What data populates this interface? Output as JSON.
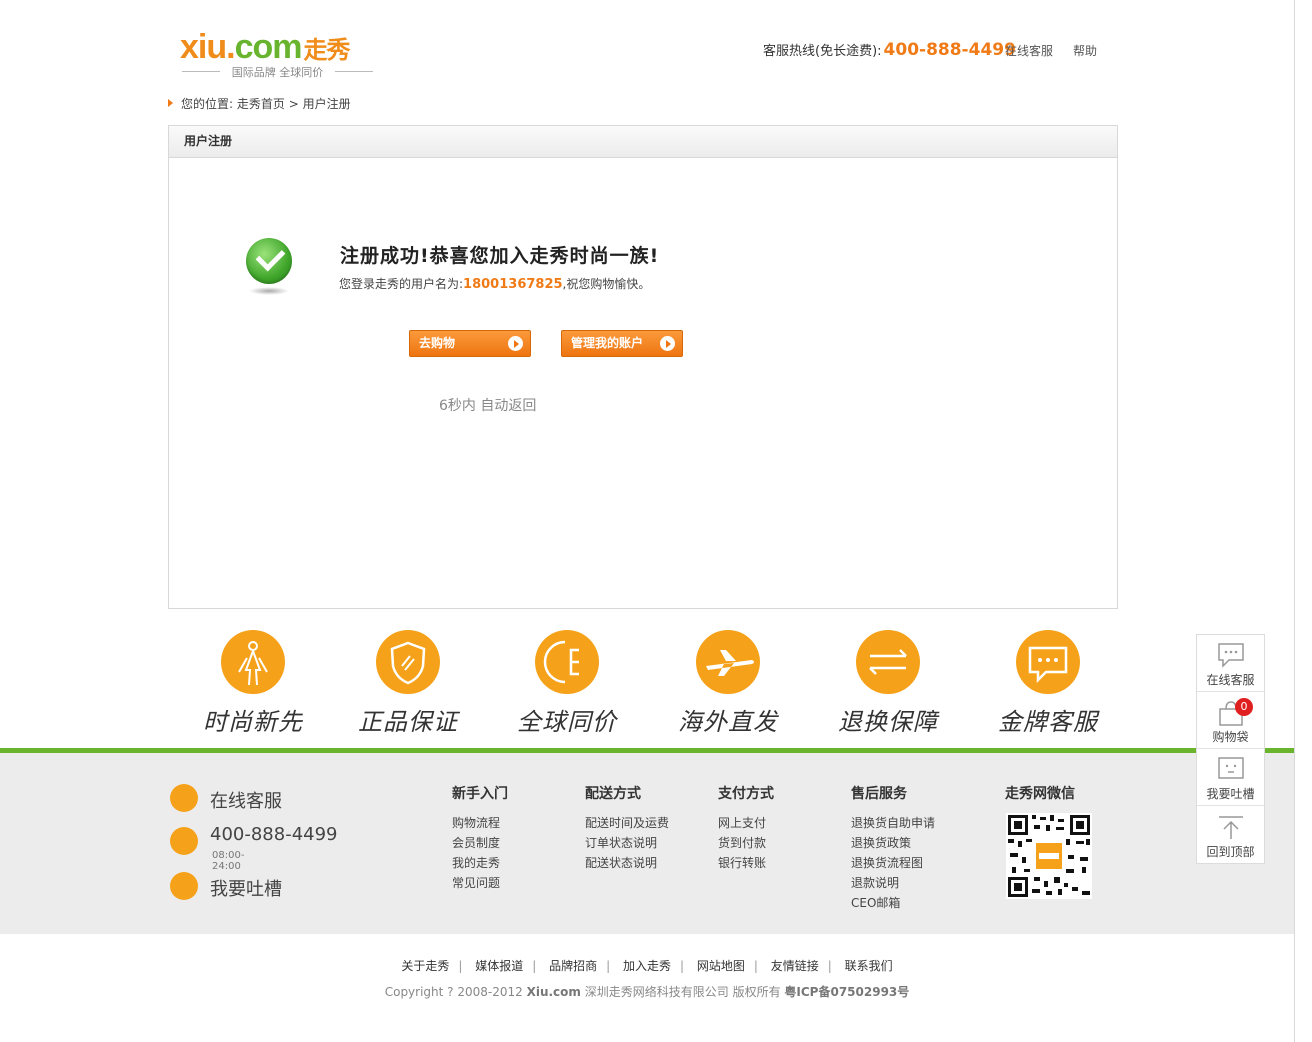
{
  "header": {
    "logo_text": "xiu.com",
    "logo_cn": "走秀",
    "logo_slogan": "国际品牌  全球同价",
    "hotline_label": "客服热线(免长途费):",
    "hotline_number": "400-888-4499",
    "link_online_service": "在线客服",
    "link_help": "帮助"
  },
  "breadcrumb": {
    "prefix": "您的位置:",
    "home": "走秀首页",
    "sep": ">",
    "current": "用户注册"
  },
  "panel": {
    "title": "用户注册",
    "success_title": "注册成功!恭喜您加入走秀时尚一族!",
    "sub_before": "您登录走秀的用户名为:",
    "username": "18001367825",
    "sub_after": ",祝您购物愉快。",
    "btn_shop": "去购物",
    "btn_account": "管理我的账户",
    "countdown": "6秒内 自动返回"
  },
  "features": [
    {
      "label": "时尚新先",
      "icon": "woman-figure-icon"
    },
    {
      "label": "正品保证",
      "icon": "shield-icon"
    },
    {
      "label": "全球同价",
      "icon": "currency-icon"
    },
    {
      "label": "海外直发",
      "icon": "airplane-icon"
    },
    {
      "label": "退换保障",
      "icon": "exchange-arrows-icon"
    },
    {
      "label": "金牌客服",
      "icon": "chat-bubble-icon"
    }
  ],
  "footer_service": {
    "online": "在线客服",
    "phone": "400-888-4499",
    "hours": "08:00-24:00",
    "feedback": "我要吐槽"
  },
  "footer_columns": [
    {
      "title": "新手入门",
      "links": [
        "购物流程",
        "会员制度",
        "我的走秀",
        "常见问题"
      ]
    },
    {
      "title": "配送方式",
      "links": [
        "配送时间及运费",
        "订单状态说明",
        "配送状态说明"
      ]
    },
    {
      "title": "支付方式",
      "links": [
        "网上支付",
        "货到付款",
        "银行转账"
      ]
    },
    {
      "title": "售后服务",
      "links": [
        "退换货自助申请",
        "退换货政策",
        "退换货流程图",
        "退款说明",
        "CEO邮箱"
      ]
    },
    {
      "title": "走秀网微信",
      "links": []
    }
  ],
  "bottom_links": [
    "关于走秀",
    "媒体报道",
    "品牌招商",
    "加入走秀",
    "网站地图",
    "友情链接",
    "联系我们"
  ],
  "copyright": {
    "text1": "Copyright ? 2008-2012",
    "site": "Xiu.com",
    "text2": "深圳走秀网络科技有限公司  版权所有",
    "icp": "粤ICP备07502993号"
  },
  "sidebar": {
    "items": [
      {
        "label": "在线客服",
        "icon": "chat-icon"
      },
      {
        "label": "购物袋",
        "icon": "shopping-bag-icon",
        "badge": "0"
      },
      {
        "label": "我要吐槽",
        "icon": "feedback-icon"
      },
      {
        "label": "回到顶部",
        "icon": "arrow-up-icon"
      }
    ]
  },
  "colors": {
    "accent": "#f07b16",
    "green": "#6ab42e",
    "feature_circle": "#f5a21a"
  }
}
